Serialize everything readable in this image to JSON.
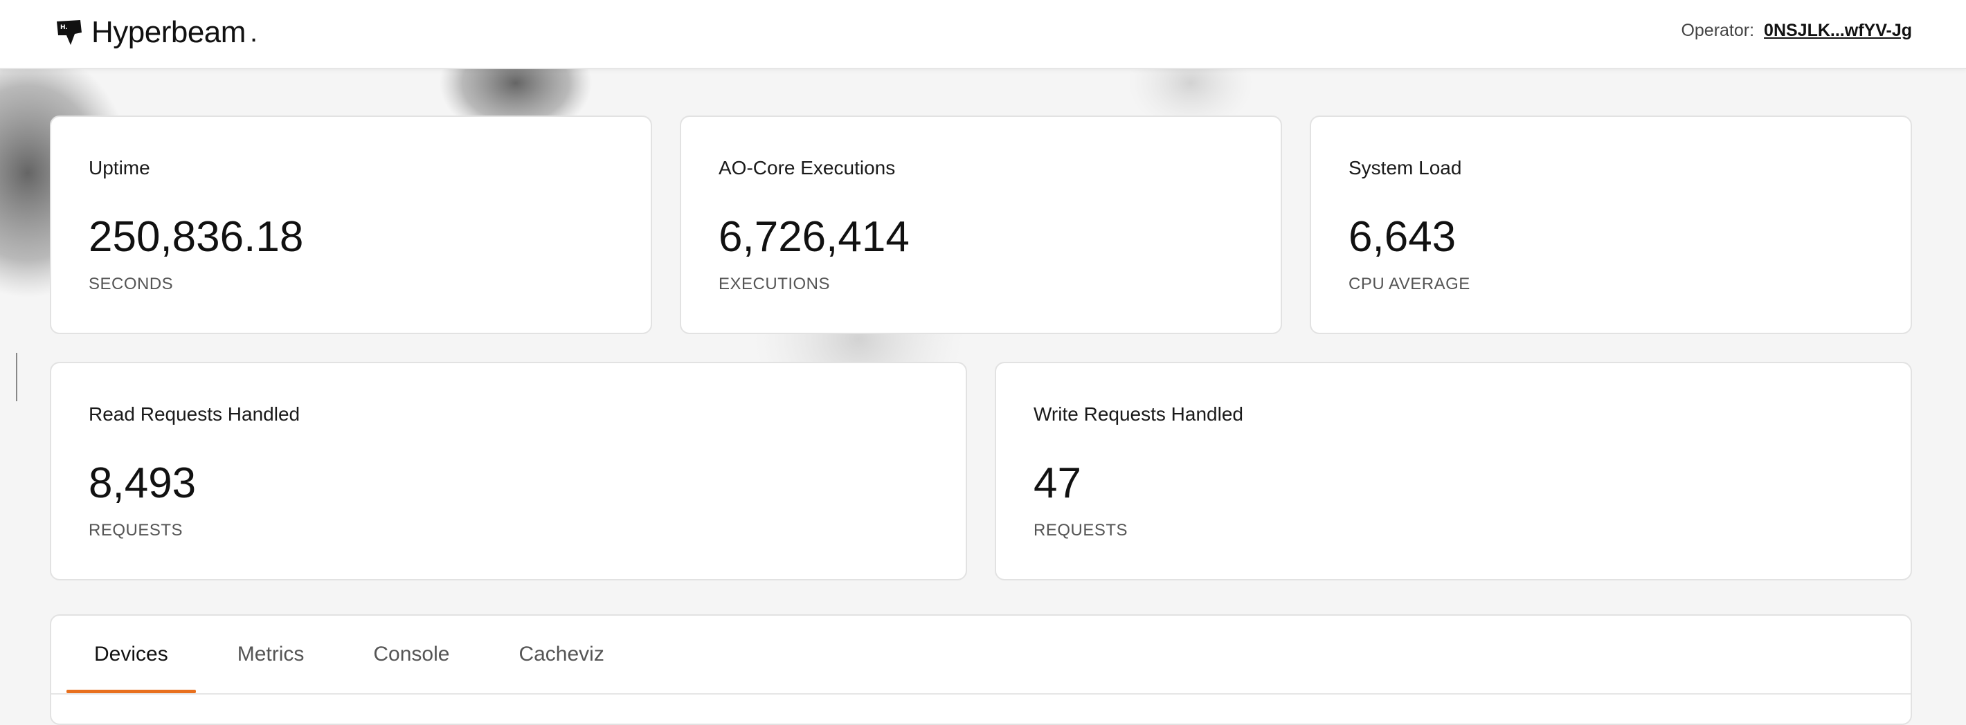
{
  "header": {
    "brand_name": "Hyperbeam",
    "brand_dot": ".",
    "logo_icon": "hyperbeam-flag-icon",
    "operator_label": "Operator:",
    "operator_value": "0NSJLK...wfYV-Jg"
  },
  "stats_top": [
    {
      "title": "Uptime",
      "value": "250,836.18",
      "unit": "SECONDS"
    },
    {
      "title": "AO-Core Executions",
      "value": "6,726,414",
      "unit": "EXECUTIONS"
    },
    {
      "title": "System Load",
      "value": "6,643",
      "unit": "CPU AVERAGE"
    }
  ],
  "stats_bottom": [
    {
      "title": "Read Requests Handled",
      "value": "8,493",
      "unit": "REQUESTS"
    },
    {
      "title": "Write Requests Handled",
      "value": "47",
      "unit": "REQUESTS"
    }
  ],
  "tabs": [
    {
      "label": "Devices",
      "active": true
    },
    {
      "label": "Metrics",
      "active": false
    },
    {
      "label": "Console",
      "active": false
    },
    {
      "label": "Cacheviz",
      "active": false
    }
  ],
  "colors": {
    "accent": "#e8701e",
    "background": "#f5f5f5",
    "card": "#ffffff",
    "border": "#e2e2e2"
  }
}
